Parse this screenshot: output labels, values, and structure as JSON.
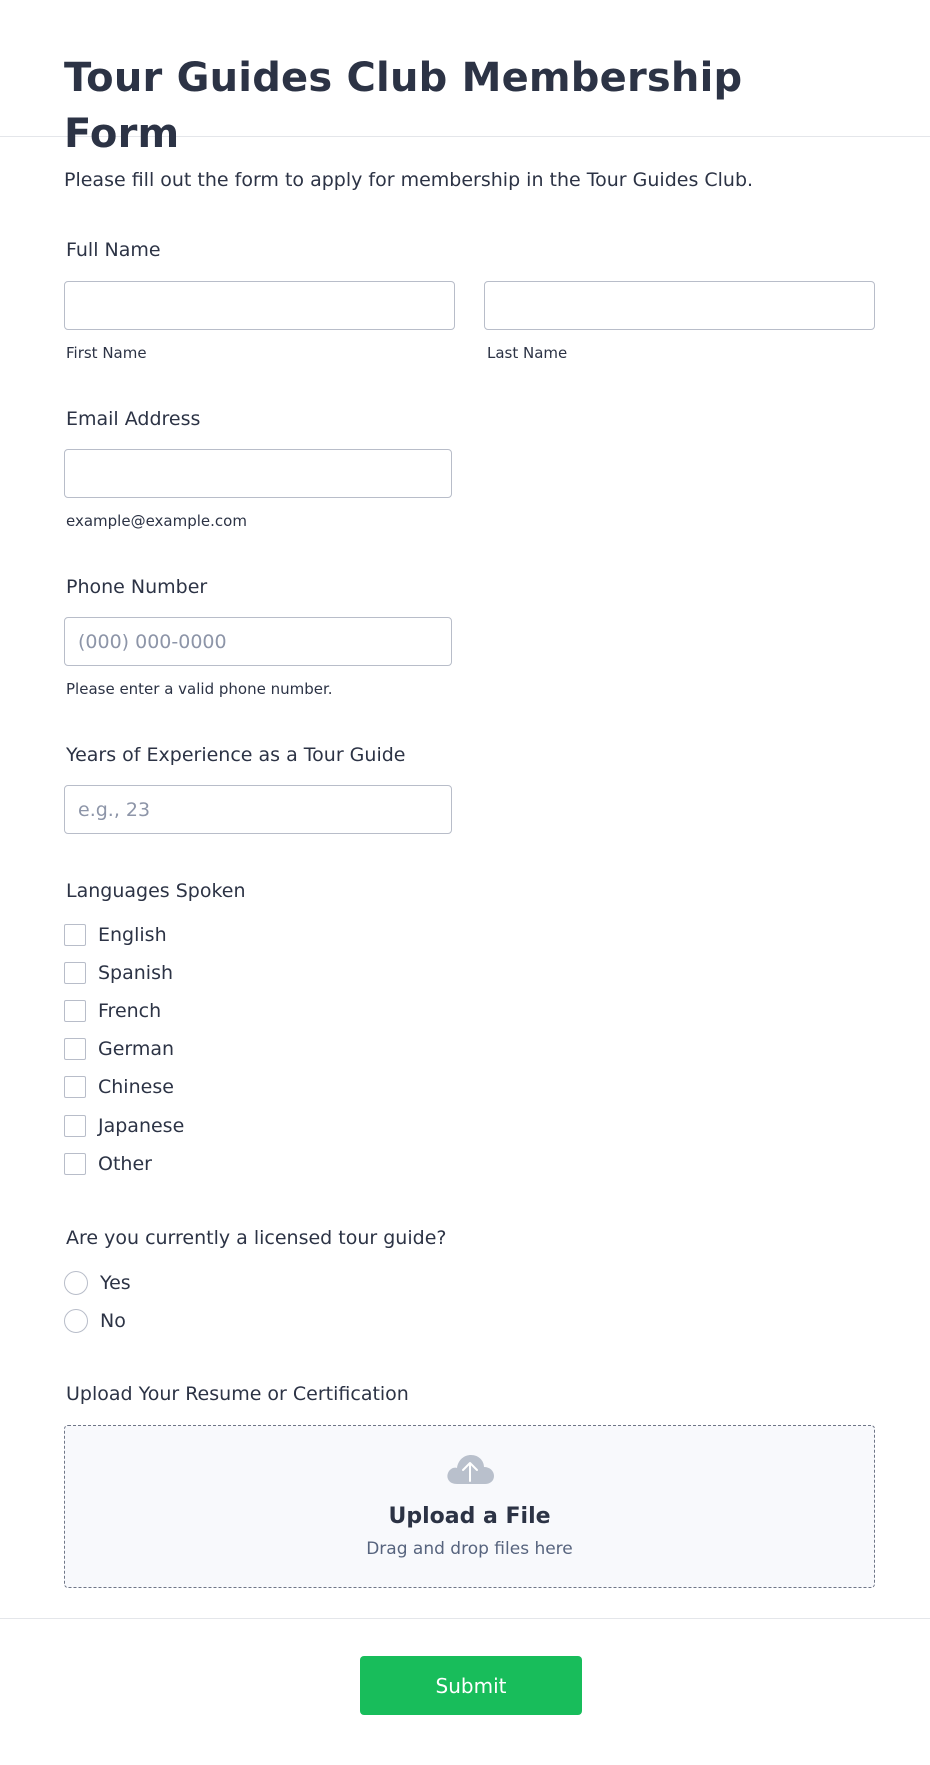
{
  "form": {
    "title": "Tour Guides Club Membership Form",
    "subtitle": "Please fill out the form to apply for membership in the Tour Guides Club."
  },
  "full_name": {
    "label": "Full Name",
    "first_sublabel": "First Name",
    "last_sublabel": "Last Name",
    "first_value": "",
    "last_value": ""
  },
  "email": {
    "label": "Email Address",
    "sublabel": "example@example.com",
    "value": ""
  },
  "phone": {
    "label": "Phone Number",
    "placeholder": "(000) 000-0000",
    "sublabel": "Please enter a valid phone number.",
    "value": ""
  },
  "experience": {
    "label": "Years of Experience as a Tour Guide",
    "placeholder": "e.g., 23",
    "value": ""
  },
  "languages": {
    "label": "Languages Spoken",
    "options": [
      "English",
      "Spanish",
      "French",
      "German",
      "Chinese",
      "Japanese",
      "Other"
    ]
  },
  "licensed": {
    "label": "Are you currently a licensed tour guide?",
    "options": [
      "Yes",
      "No"
    ]
  },
  "upload": {
    "label": "Upload Your Resume or Certification",
    "title": "Upload a File",
    "subtitle": "Drag and drop files here",
    "icon": "cloud-upload-icon"
  },
  "submit": {
    "label": "Submit"
  },
  "colors": {
    "text": "#2c3345",
    "border": "#b8bdc9",
    "placeholder": "#8d95a8",
    "submit_bg": "#18bd5b",
    "upload_bg": "#f8f9fc"
  }
}
